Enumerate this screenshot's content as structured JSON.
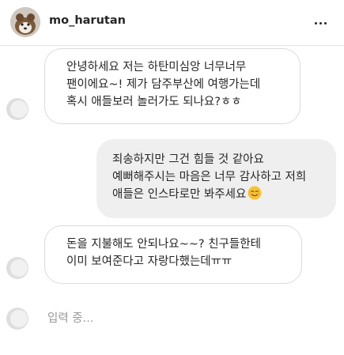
{
  "header": {
    "username": "mo_harutan",
    "more_icon": "more-horizontal-icon"
  },
  "messages": [
    {
      "direction": "incoming",
      "lines": [
        "안녕하세요 저는 하탄미심앙 너무너무",
        "팬이에요~! 제가 담주부산에 여행가는데",
        "혹시 애들보러 놀러가도 되나요?ㅎㅎ"
      ]
    },
    {
      "direction": "outgoing",
      "lines": [
        "죄송하지만 그건 힘들 것 같아요",
        "예뻐해주시는 마음은 너무 감사하고 저희",
        "애들은 인스타로만 봐주세요"
      ],
      "emoji": "smiling-face-icon"
    },
    {
      "direction": "incoming",
      "lines": [
        "돈을 지불해도 안되나요~~? 친구들한테",
        "이미 보여준다고 자랑다했는데ㅠㅠ"
      ]
    }
  ],
  "typing": {
    "text": "입력 중..."
  },
  "colors": {
    "incoming_bubble_border": "#dbdbdb",
    "outgoing_bubble_bg": "#efefef",
    "text": "#262626",
    "typing_text": "#9a9a9a",
    "emoji": "#f7c233"
  }
}
